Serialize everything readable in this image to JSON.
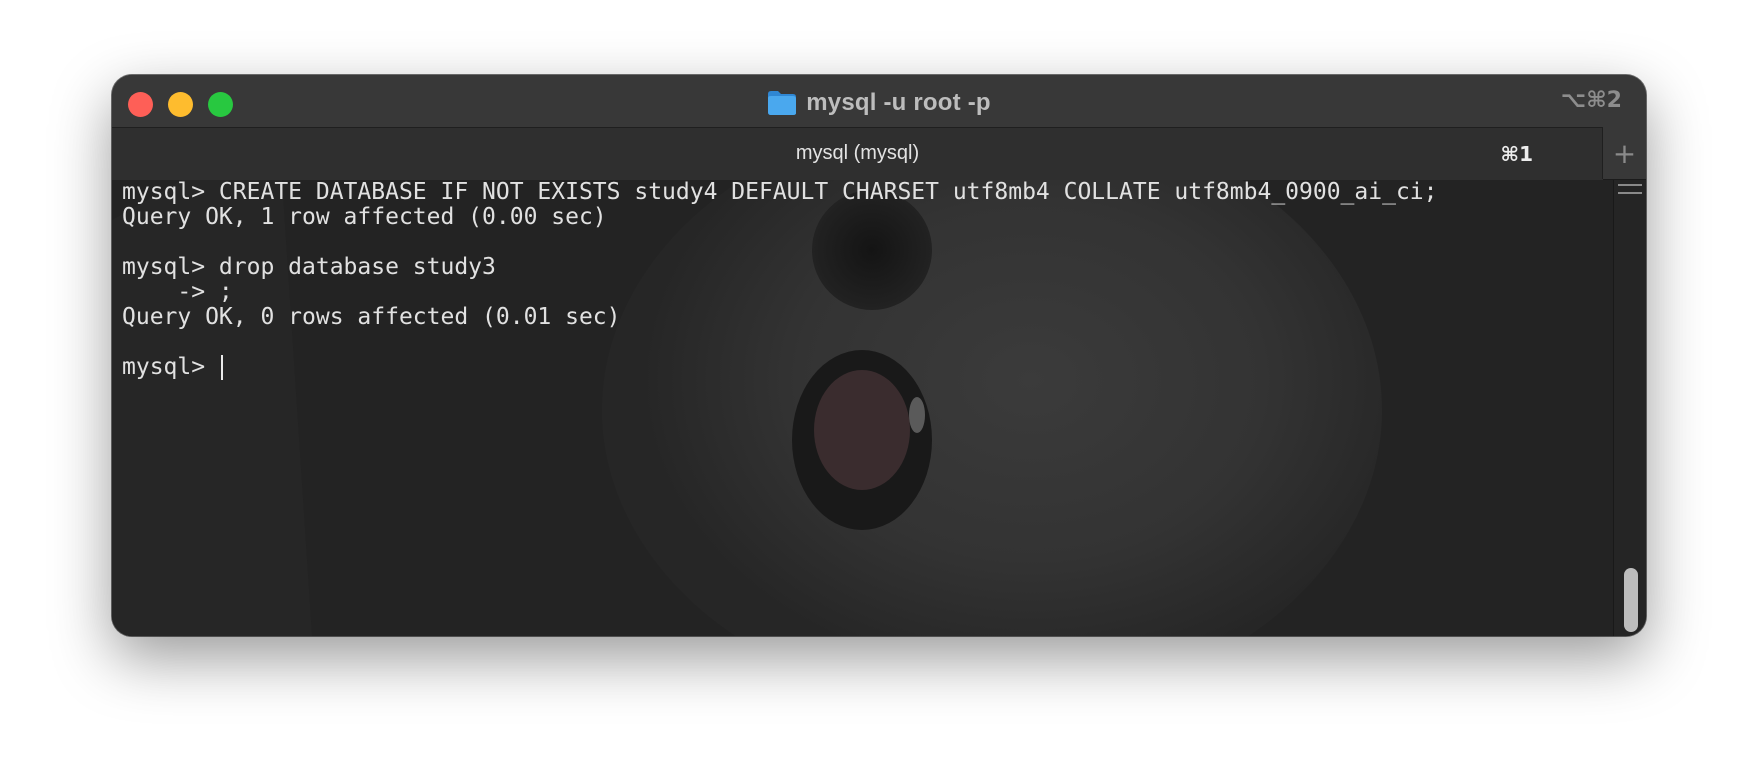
{
  "window": {
    "title": "mysql -u root -p",
    "shortcut": "⌥⌘2",
    "folder_icon": "folder-icon",
    "colors": {
      "close": "#fe5f57",
      "minimize": "#febc2e",
      "maximize": "#28c840",
      "folder": "#3a9be8"
    }
  },
  "tabs": [
    {
      "label": "mysql (mysql)",
      "shortcut": "⌘1"
    }
  ],
  "tab_add_label": "+",
  "terminal": {
    "lines": [
      "mysql> CREATE DATABASE IF NOT EXISTS study4 DEFAULT CHARSET utf8mb4 COLLATE utf8mb4_0900_ai_ci;",
      "Query OK, 1 row affected (0.00 sec)",
      "",
      "mysql> drop database study3",
      "    -> ;",
      "Query OK, 0 rows affected (0.01 sec)",
      "",
      "mysql> "
    ]
  }
}
